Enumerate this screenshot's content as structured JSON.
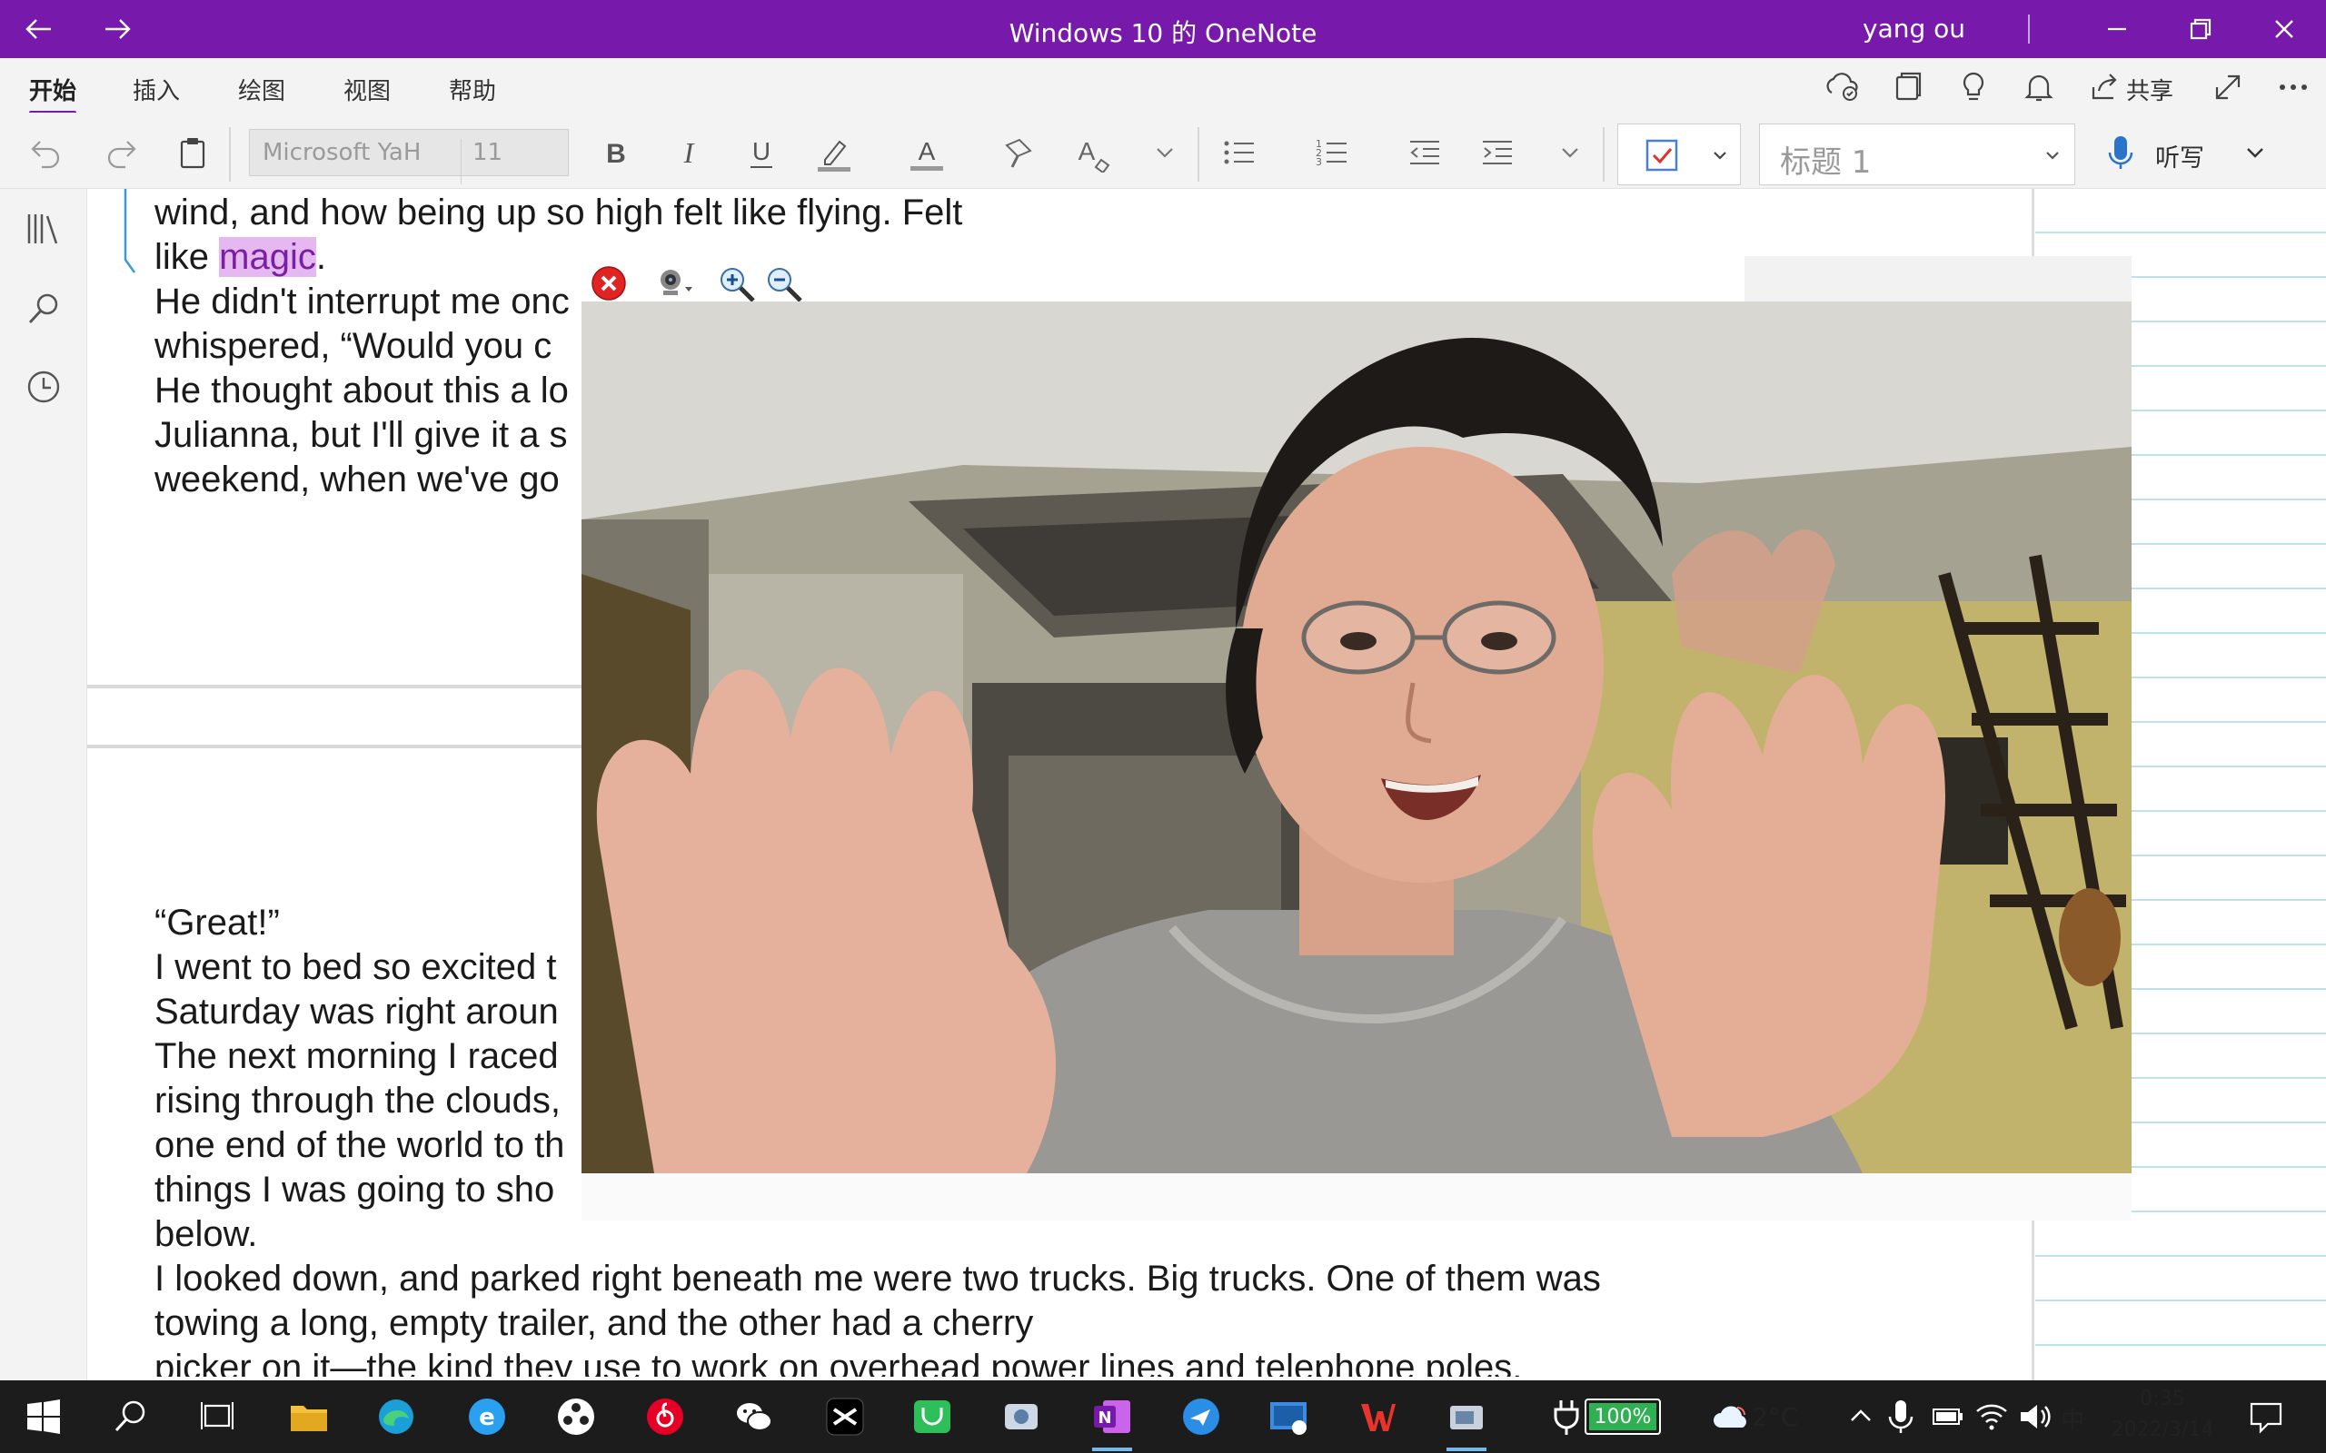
{
  "titlebar": {
    "title": "Windows 10 的 OneNote",
    "user": "yang ou"
  },
  "tabs": [
    "开始",
    "插入",
    "绘图",
    "视图",
    "帮助"
  ],
  "share_label": "共享",
  "toolbar": {
    "font": "Microsoft YaH",
    "size": "11",
    "style": "标题 1",
    "dictate": "听写"
  },
  "note": {
    "top_lines": [
      "wind, and how being up so high felt like flying. Felt",
      "like ",
      ".",
      "He didn't interrupt me onc",
      "whispered, “Would you c",
      "He thought about this a lo",
      "Julianna, but I'll give it a s",
      "weekend, when we've go"
    ],
    "highlight": "magic",
    "bottom_lines": [
      "“Great!”",
      "I went to bed so excited t",
      "Saturday was right aroun",
      "The next morning I raced",
      "rising through the clouds,",
      "one end of the world to th",
      "things I was going to sho",
      "below.",
      "I looked down, and parked right beneath me were two trucks. Big trucks. One of them was",
      "towing a long, empty trailer, and the other had a cherry",
      "picker on it—the kind they use to work on overhead power lines and telephone poles."
    ]
  },
  "taskbar": {
    "battery": "100%",
    "temp": "2°C",
    "ime": "中",
    "time": "0:35",
    "date": "2022/3/14"
  },
  "colors": {
    "accent": "#7719aa",
    "highlight": "#e6b8f2",
    "taskbar": "#1c1c1c"
  }
}
